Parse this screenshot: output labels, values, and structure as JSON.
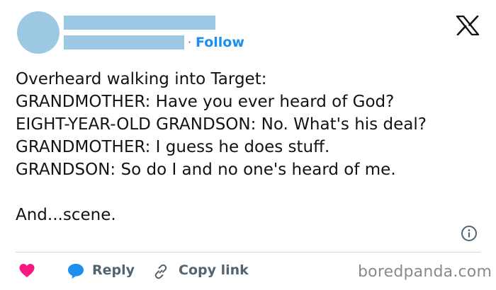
{
  "header": {
    "follow_label": "Follow",
    "separator": "·"
  },
  "tweet": {
    "lines": [
      "Overheard walking into Target:",
      "GRANDMOTHER: Have you ever heard of God?",
      "EIGHT-YEAR-OLD GRANDSON: No. What's his deal?",
      "GRANDMOTHER: I guess he does stuff.",
      "GRANDSON: So do I and no one's heard of me."
    ],
    "closing": "And...scene."
  },
  "actions": {
    "reply_label": "Reply",
    "copy_link_label": "Copy link"
  },
  "watermark": "boredpanda.com",
  "icons": {
    "logo": "x-logo-icon",
    "info": "info-icon",
    "like": "heart-icon",
    "reply": "reply-bubble-icon",
    "copy": "link-icon"
  },
  "colors": {
    "accent": "#1d8ff0",
    "redaction": "#9dc8e3",
    "heart": "#f91880",
    "secondary_text": "#536471"
  }
}
